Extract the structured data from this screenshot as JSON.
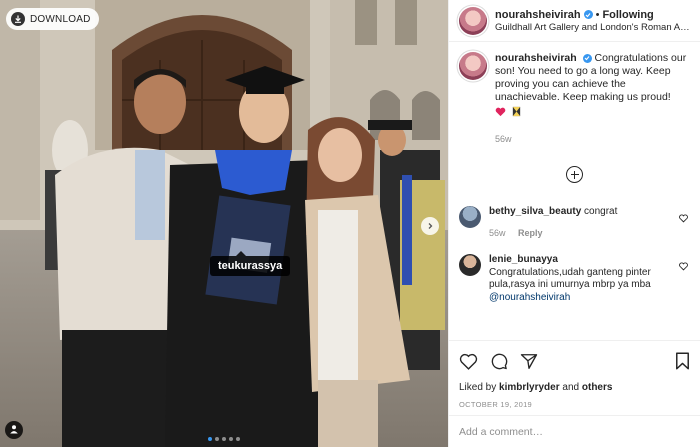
{
  "photo": {
    "download_label": "DOWNLOAD",
    "tag_label": "teukurassya",
    "carousel_dots": 5,
    "active_dot": 0
  },
  "post": {
    "author": "nourahsheivirah",
    "follow_label": "Following",
    "separator": "•",
    "location": "Guildhall Art Gallery and London's Roman Am…"
  },
  "caption": {
    "username": "nourahsheivirah",
    "text": "Congratulations our son! You need to go a long way. Keep proving you can achieve the unachievable. Keep making us proud!",
    "time": "56w"
  },
  "comments": [
    {
      "username": "bethy_silva_beauty",
      "text": "congrat",
      "time": "56w",
      "reply_label": "Reply"
    },
    {
      "username": "lenie_bunayya",
      "text": "Congratulations,udah ganteng pinter pula,rasya ini umurnya mbrp ya mba",
      "mention": "@nourahsheivirah"
    }
  ],
  "footer": {
    "liked_prefix": "Liked by",
    "liked_user": "kimbrlyryder",
    "liked_and": "and",
    "liked_others": "others",
    "date": "OCTOBER 19, 2019",
    "add_comment_placeholder": "Add a comment…"
  },
  "icons": {
    "download": "download-icon",
    "verified": "verified-badge-icon",
    "more": "plus-circle-icon",
    "heart": "heart-icon",
    "comment": "comment-icon",
    "share": "share-icon",
    "save": "bookmark-icon",
    "user_tags": "user-tags-icon",
    "next": "chevron-right-icon"
  },
  "colors": {
    "accent": "#3897f0",
    "heart": "#ed4956",
    "text": "#262626",
    "muted": "#8e8e8e"
  }
}
